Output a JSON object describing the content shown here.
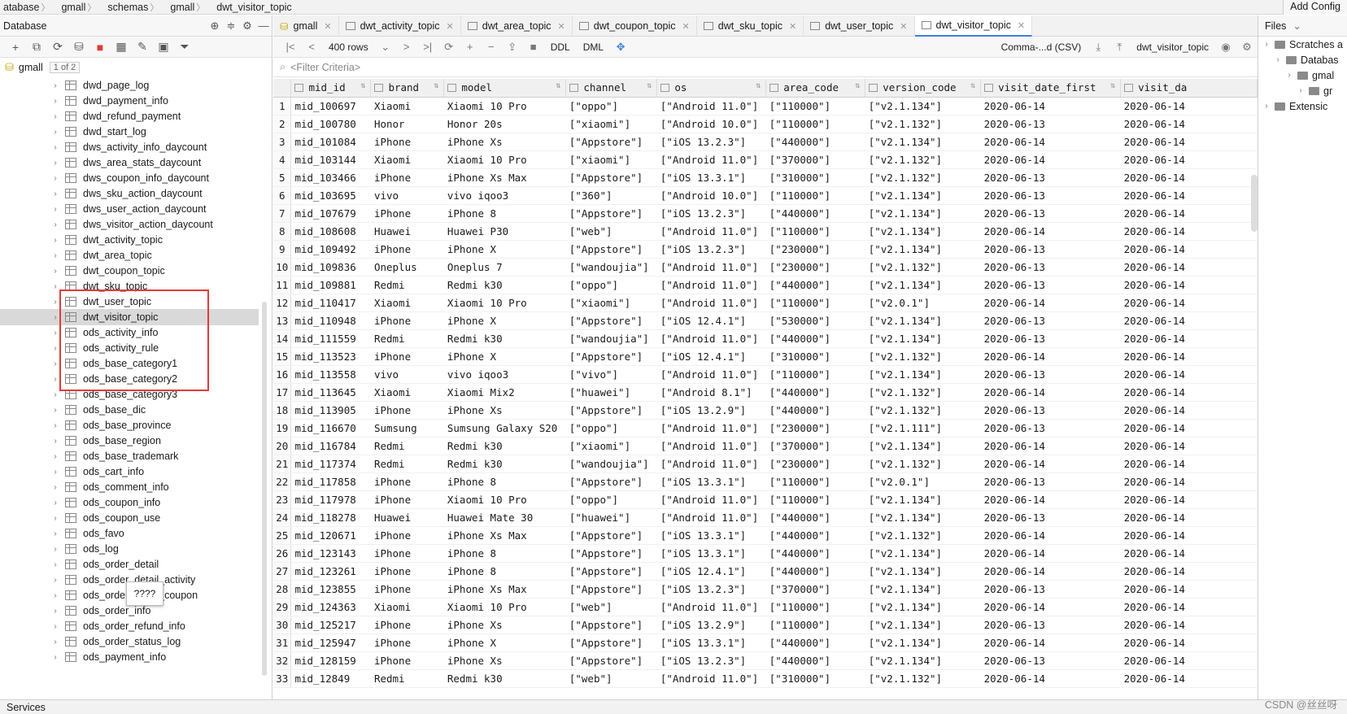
{
  "breadcrumb": [
    "atabase",
    "gmall",
    "schemas",
    "gmall",
    "dwt_visitor_topic"
  ],
  "add_config": "Add Config",
  "left_panel": {
    "title": "Database",
    "root": "gmall",
    "page": "1 of 2",
    "selected": "dwt_visitor_topic",
    "tables": [
      "dwd_page_log",
      "dwd_payment_info",
      "dwd_refund_payment",
      "dwd_start_log",
      "dws_activity_info_daycount",
      "dws_area_stats_daycount",
      "dws_coupon_info_daycount",
      "dws_sku_action_daycount",
      "dws_user_action_daycount",
      "dws_visitor_action_daycount",
      "dwt_activity_topic",
      "dwt_area_topic",
      "dwt_coupon_topic",
      "dwt_sku_topic",
      "dwt_user_topic",
      "dwt_visitor_topic",
      "ods_activity_info",
      "ods_activity_rule",
      "ods_base_category1",
      "ods_base_category2",
      "ods_base_category3",
      "ods_base_dic",
      "ods_base_province",
      "ods_base_region",
      "ods_base_trademark",
      "ods_cart_info",
      "ods_comment_info",
      "ods_coupon_info",
      "ods_coupon_use",
      "ods_favo",
      "ods_log",
      "ods_order_detail",
      "ods_order_detail_activity",
      "ods_order_detail_coupon",
      "ods_order_info",
      "ods_order_refund_info",
      "ods_order_status_log",
      "ods_payment_info"
    ],
    "tooltip": "????"
  },
  "tabs": [
    {
      "label": "gmall"
    },
    {
      "label": "dwt_activity_topic"
    },
    {
      "label": "dwt_area_topic"
    },
    {
      "label": "dwt_coupon_topic"
    },
    {
      "label": "dwt_sku_topic"
    },
    {
      "label": "dwt_user_topic"
    },
    {
      "label": "dwt_visitor_topic",
      "active": true
    }
  ],
  "toolbar": {
    "rows": "400 rows",
    "ddl": "DDL",
    "dml": "DML",
    "export_format": "Comma-...d (CSV)",
    "table_selector": "dwt_visitor_topic"
  },
  "filter_placeholder": "<Filter Criteria>",
  "columns": [
    "mid_id",
    "brand",
    "model",
    "channel",
    "os",
    "area_code",
    "version_code",
    "visit_date_first",
    "visit_da"
  ],
  "rows": [
    [
      "mid_100697",
      "Xiaomi",
      "Xiaomi 10 Pro",
      "[\"oppo\"]",
      "[\"Android 11.0\"]",
      "[\"110000\"]",
      "[\"v2.1.134\"]",
      "2020-06-14",
      "2020-06-14"
    ],
    [
      "mid_100780",
      "Honor",
      "Honor 20s",
      "[\"xiaomi\"]",
      "[\"Android 10.0\"]",
      "[\"110000\"]",
      "[\"v2.1.132\"]",
      "2020-06-13",
      "2020-06-14"
    ],
    [
      "mid_101084",
      "iPhone",
      "iPhone Xs",
      "[\"Appstore\"]",
      "[\"iOS 13.2.3\"]",
      "[\"440000\"]",
      "[\"v2.1.134\"]",
      "2020-06-14",
      "2020-06-14"
    ],
    [
      "mid_103144",
      "Xiaomi",
      "Xiaomi 10 Pro",
      "[\"xiaomi\"]",
      "[\"Android 11.0\"]",
      "[\"370000\"]",
      "[\"v2.1.132\"]",
      "2020-06-14",
      "2020-06-14"
    ],
    [
      "mid_103466",
      "iPhone",
      "iPhone Xs Max",
      "[\"Appstore\"]",
      "[\"iOS 13.3.1\"]",
      "[\"310000\"]",
      "[\"v2.1.132\"]",
      "2020-06-13",
      "2020-06-14"
    ],
    [
      "mid_103695",
      "vivo",
      "vivo iqoo3",
      "[\"360\"]",
      "[\"Android 10.0\"]",
      "[\"110000\"]",
      "[\"v2.1.134\"]",
      "2020-06-13",
      "2020-06-14"
    ],
    [
      "mid_107679",
      "iPhone",
      "iPhone 8",
      "[\"Appstore\"]",
      "[\"iOS 13.2.3\"]",
      "[\"440000\"]",
      "[\"v2.1.134\"]",
      "2020-06-13",
      "2020-06-14"
    ],
    [
      "mid_108608",
      "Huawei",
      "Huawei P30",
      "[\"web\"]",
      "[\"Android 11.0\"]",
      "[\"110000\"]",
      "[\"v2.1.134\"]",
      "2020-06-14",
      "2020-06-14"
    ],
    [
      "mid_109492",
      "iPhone",
      "iPhone X",
      "[\"Appstore\"]",
      "[\"iOS 13.2.3\"]",
      "[\"230000\"]",
      "[\"v2.1.134\"]",
      "2020-06-13",
      "2020-06-14"
    ],
    [
      "mid_109836",
      "Oneplus",
      "Oneplus 7",
      "[\"wandoujia\"]",
      "[\"Android 11.0\"]",
      "[\"230000\"]",
      "[\"v2.1.132\"]",
      "2020-06-13",
      "2020-06-14"
    ],
    [
      "mid_109881",
      "Redmi",
      "Redmi k30",
      "[\"oppo\"]",
      "[\"Android 11.0\"]",
      "[\"440000\"]",
      "[\"v2.1.134\"]",
      "2020-06-13",
      "2020-06-14"
    ],
    [
      "mid_110417",
      "Xiaomi",
      "Xiaomi 10 Pro",
      "[\"xiaomi\"]",
      "[\"Android 11.0\"]",
      "[\"110000\"]",
      "[\"v2.0.1\"]",
      "2020-06-14",
      "2020-06-14"
    ],
    [
      "mid_110948",
      "iPhone",
      "iPhone X",
      "[\"Appstore\"]",
      "[\"iOS 12.4.1\"]",
      "[\"530000\"]",
      "[\"v2.1.134\"]",
      "2020-06-13",
      "2020-06-14"
    ],
    [
      "mid_111559",
      "Redmi",
      "Redmi k30",
      "[\"wandoujia\"]",
      "[\"Android 11.0\"]",
      "[\"440000\"]",
      "[\"v2.1.134\"]",
      "2020-06-13",
      "2020-06-14"
    ],
    [
      "mid_113523",
      "iPhone",
      "iPhone X",
      "[\"Appstore\"]",
      "[\"iOS 12.4.1\"]",
      "[\"310000\"]",
      "[\"v2.1.132\"]",
      "2020-06-14",
      "2020-06-14"
    ],
    [
      "mid_113558",
      "vivo",
      "vivo iqoo3",
      "[\"vivo\"]",
      "[\"Android 11.0\"]",
      "[\"110000\"]",
      "[\"v2.1.134\"]",
      "2020-06-13",
      "2020-06-14"
    ],
    [
      "mid_113645",
      "Xiaomi",
      "Xiaomi Mix2",
      "[\"huawei\"]",
      "[\"Android 8.1\"]",
      "[\"440000\"]",
      "[\"v2.1.132\"]",
      "2020-06-14",
      "2020-06-14"
    ],
    [
      "mid_113905",
      "iPhone",
      "iPhone Xs",
      "[\"Appstore\"]",
      "[\"iOS 13.2.9\"]",
      "[\"440000\"]",
      "[\"v2.1.132\"]",
      "2020-06-13",
      "2020-06-14"
    ],
    [
      "mid_116670",
      "Sumsung",
      "Sumsung Galaxy S20",
      "[\"oppo\"]",
      "[\"Android 11.0\"]",
      "[\"230000\"]",
      "[\"v2.1.111\"]",
      "2020-06-13",
      "2020-06-14"
    ],
    [
      "mid_116784",
      "Redmi",
      "Redmi k30",
      "[\"xiaomi\"]",
      "[\"Android 11.0\"]",
      "[\"370000\"]",
      "[\"v2.1.134\"]",
      "2020-06-14",
      "2020-06-14"
    ],
    [
      "mid_117374",
      "Redmi",
      "Redmi k30",
      "[\"wandoujia\"]",
      "[\"Android 11.0\"]",
      "[\"230000\"]",
      "[\"v2.1.132\"]",
      "2020-06-14",
      "2020-06-14"
    ],
    [
      "mid_117858",
      "iPhone",
      "iPhone 8",
      "[\"Appstore\"]",
      "[\"iOS 13.3.1\"]",
      "[\"110000\"]",
      "[\"v2.0.1\"]",
      "2020-06-13",
      "2020-06-14"
    ],
    [
      "mid_117978",
      "iPhone",
      "Xiaomi 10 Pro",
      "[\"oppo\"]",
      "[\"Android 11.0\"]",
      "[\"110000\"]",
      "[\"v2.1.134\"]",
      "2020-06-14",
      "2020-06-14"
    ],
    [
      "mid_118278",
      "Huawei",
      "Huawei Mate 30",
      "[\"huawei\"]",
      "[\"Android 11.0\"]",
      "[\"440000\"]",
      "[\"v2.1.134\"]",
      "2020-06-13",
      "2020-06-14"
    ],
    [
      "mid_120671",
      "iPhone",
      "iPhone Xs Max",
      "[\"Appstore\"]",
      "[\"iOS 13.3.1\"]",
      "[\"440000\"]",
      "[\"v2.1.132\"]",
      "2020-06-14",
      "2020-06-14"
    ],
    [
      "mid_123143",
      "iPhone",
      "iPhone 8",
      "[\"Appstore\"]",
      "[\"iOS 13.3.1\"]",
      "[\"440000\"]",
      "[\"v2.1.134\"]",
      "2020-06-14",
      "2020-06-14"
    ],
    [
      "mid_123261",
      "iPhone",
      "iPhone 8",
      "[\"Appstore\"]",
      "[\"iOS 12.4.1\"]",
      "[\"440000\"]",
      "[\"v2.1.134\"]",
      "2020-06-14",
      "2020-06-14"
    ],
    [
      "mid_123855",
      "iPhone",
      "iPhone Xs Max",
      "[\"Appstore\"]",
      "[\"iOS 13.2.3\"]",
      "[\"370000\"]",
      "[\"v2.1.134\"]",
      "2020-06-13",
      "2020-06-14"
    ],
    [
      "mid_124363",
      "Xiaomi",
      "Xiaomi 10 Pro",
      "[\"web\"]",
      "[\"Android 11.0\"]",
      "[\"110000\"]",
      "[\"v2.1.134\"]",
      "2020-06-14",
      "2020-06-14"
    ],
    [
      "mid_125217",
      "iPhone",
      "iPhone Xs",
      "[\"Appstore\"]",
      "[\"iOS 13.2.9\"]",
      "[\"110000\"]",
      "[\"v2.1.134\"]",
      "2020-06-13",
      "2020-06-14"
    ],
    [
      "mid_125947",
      "iPhone",
      "iPhone X",
      "[\"Appstore\"]",
      "[\"iOS 13.3.1\"]",
      "[\"440000\"]",
      "[\"v2.1.134\"]",
      "2020-06-14",
      "2020-06-14"
    ],
    [
      "mid_128159",
      "iPhone",
      "iPhone Xs",
      "[\"Appstore\"]",
      "[\"iOS 13.2.3\"]",
      "[\"440000\"]",
      "[\"v2.1.134\"]",
      "2020-06-13",
      "2020-06-14"
    ],
    [
      "mid_12849",
      "Redmi",
      "Redmi k30",
      "[\"web\"]",
      "[\"Android 11.0\"]",
      "[\"310000\"]",
      "[\"v2.1.132\"]",
      "2020-06-14",
      "2020-06-14"
    ]
  ],
  "right_panel": {
    "title": "Files",
    "items": [
      {
        "label": "Scratches a",
        "level": 0
      },
      {
        "label": "Databas",
        "level": 1
      },
      {
        "label": "gmal",
        "level": 2
      },
      {
        "label": "gr",
        "level": 3
      },
      {
        "label": "Extensic",
        "level": 0
      }
    ]
  },
  "status": {
    "services": "Services",
    "watermark": "CSDN @丝丝呀"
  },
  "colors": {
    "accent": "#3d7fe0",
    "highlight_box": "#e53935",
    "selected_row": "#d9d9d9"
  }
}
